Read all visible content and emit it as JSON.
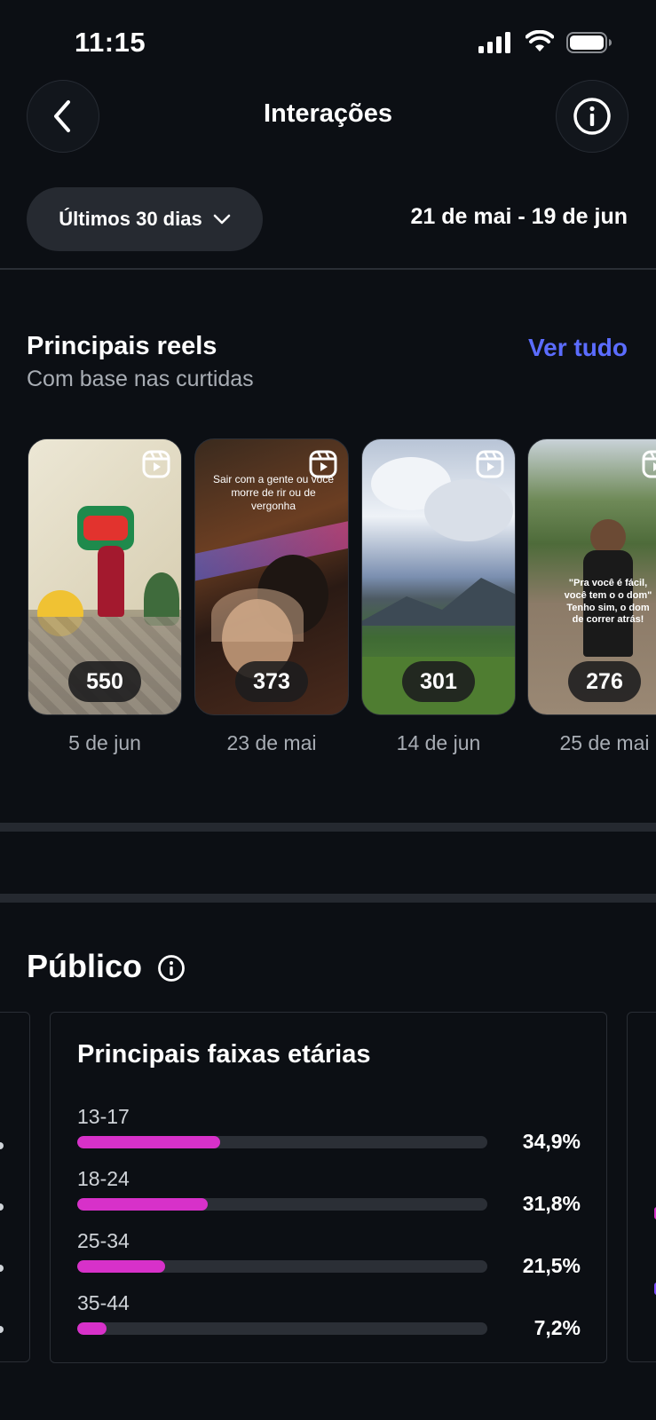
{
  "status_bar": {
    "time": "11:15"
  },
  "header": {
    "title": "Interações"
  },
  "filters": {
    "range_label": "Últimos 30 dias",
    "date_range": "21 de mai - 19 de jun"
  },
  "top_reels": {
    "title": "Principais reels",
    "subtitle": "Com base nas curtidas",
    "see_all": "Ver tudo",
    "items": [
      {
        "count": "550",
        "date": "5 de jun",
        "overlay": ""
      },
      {
        "count": "373",
        "date": "23 de mai",
        "overlay": "Sair com a gente ou você morre de rir ou de vergonha"
      },
      {
        "count": "301",
        "date": "14 de jun",
        "overlay": ""
      },
      {
        "count": "276",
        "date": "25 de mai",
        "overlay": "\"Pra você é fácil, você tem o o dom\" Tenho sim, o dom de correr atrás!"
      }
    ]
  },
  "audience": {
    "title": "Público",
    "card_title": "Principais faixas etárias",
    "accent_color": "#d731c9",
    "age_ranges": [
      {
        "label": "13-17",
        "percent_text": "34,9%",
        "share": 0.349
      },
      {
        "label": "18-24",
        "percent_text": "31,8%",
        "share": 0.318
      },
      {
        "label": "25-34",
        "percent_text": "21,5%",
        "share": 0.215
      },
      {
        "label": "35-44",
        "percent_text": "7,2%",
        "share": 0.072
      }
    ]
  }
}
